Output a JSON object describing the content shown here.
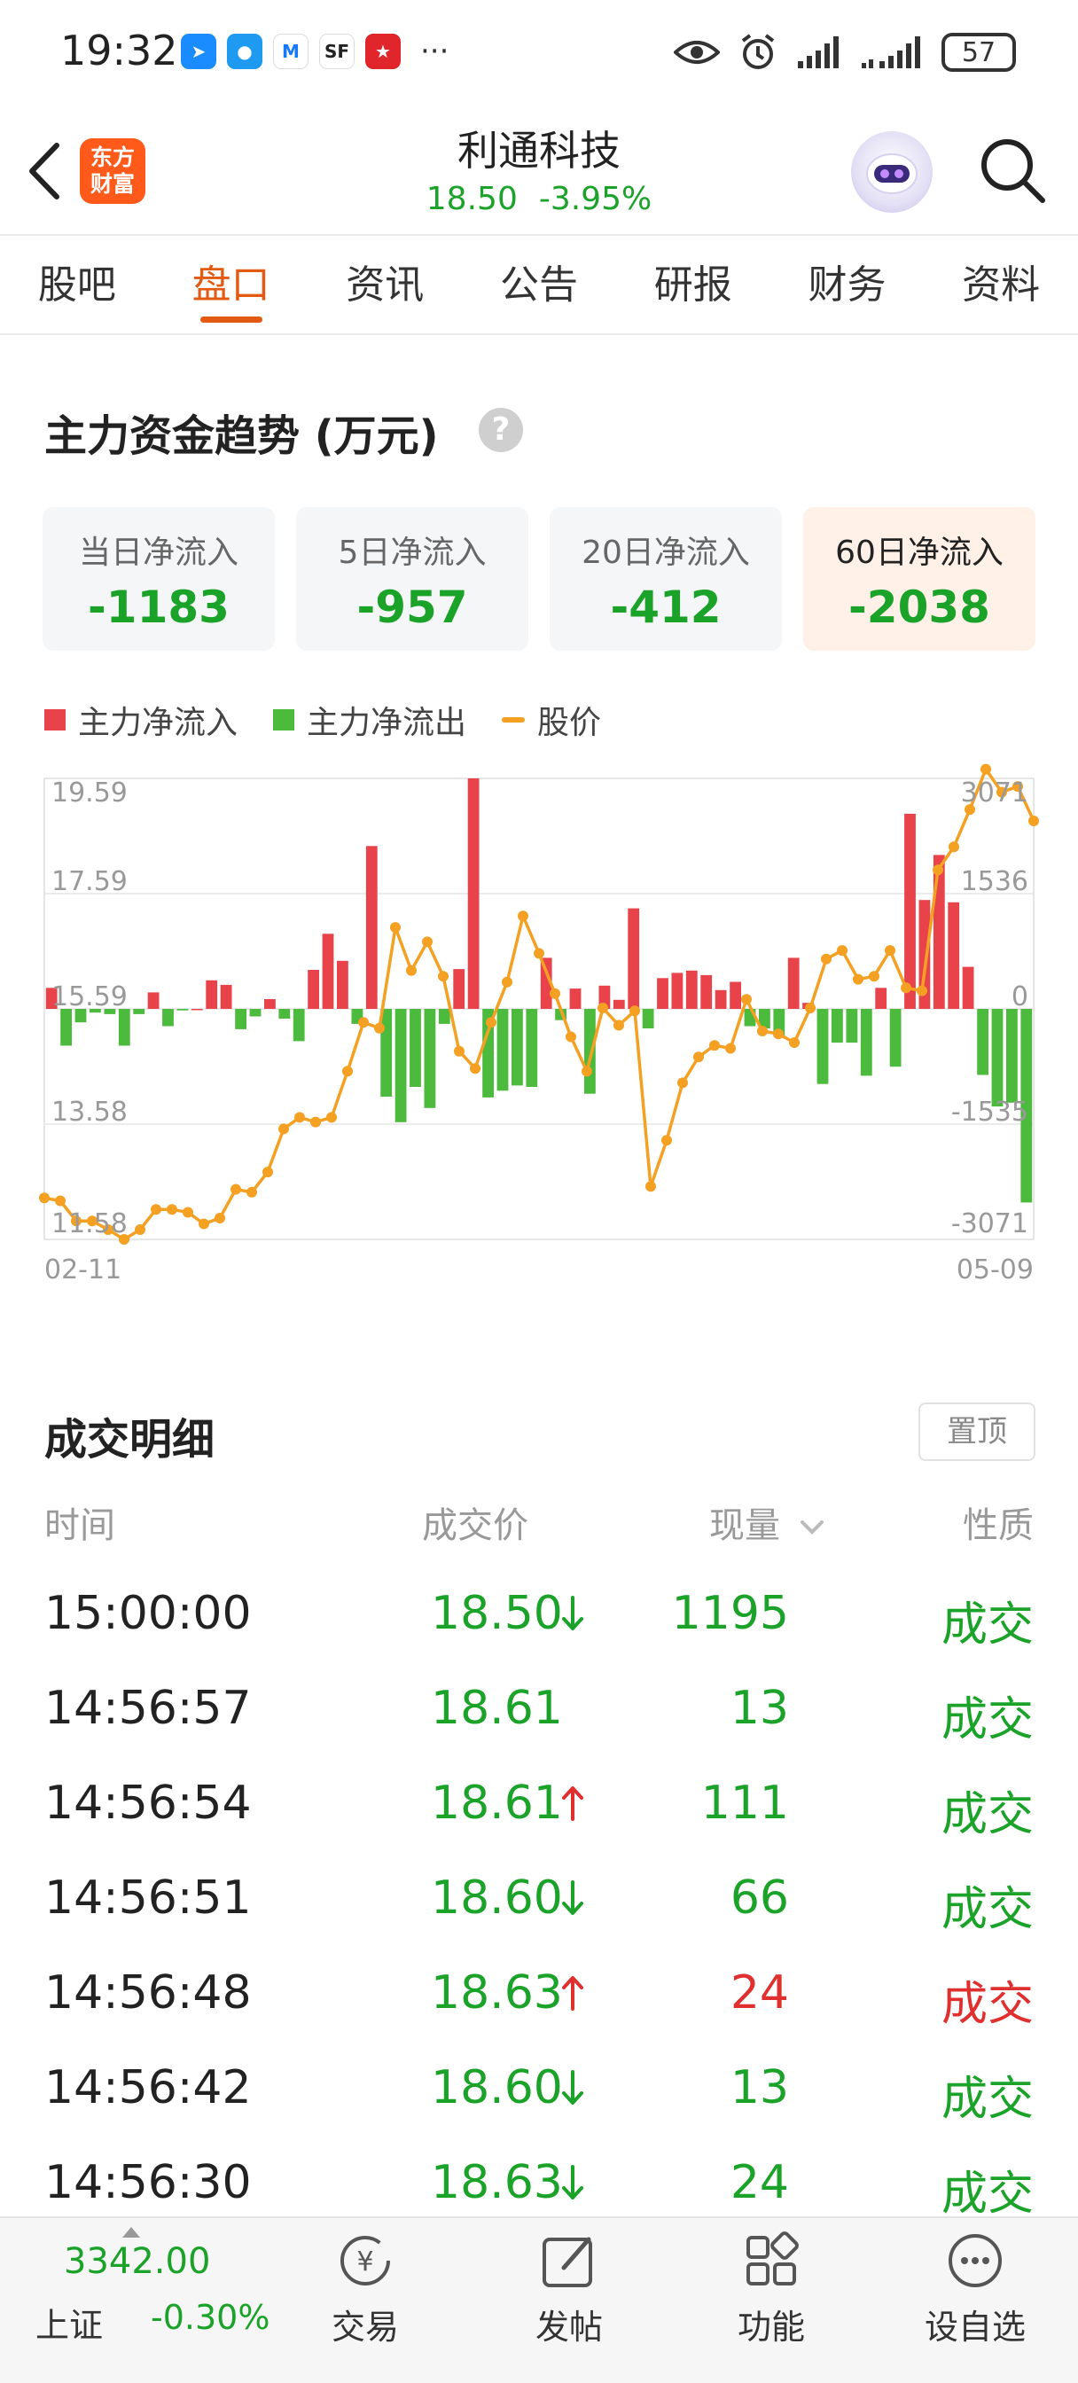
{
  "status_bar": {
    "time": "19:32",
    "battery": "57"
  },
  "header": {
    "brand_logo_text": "东方财富",
    "stock_name": "利通科技",
    "price": "18.50",
    "change_pct": "-3.95%"
  },
  "tabs": [
    {
      "label": "股吧",
      "active": false
    },
    {
      "label": "盘口",
      "active": true
    },
    {
      "label": "资讯",
      "active": false
    },
    {
      "label": "公告",
      "active": false
    },
    {
      "label": "研报",
      "active": false
    },
    {
      "label": "财务",
      "active": false
    },
    {
      "label": "资料",
      "active": false
    }
  ],
  "fund_flow": {
    "title": "主力资金趋势 (万元)",
    "help": "?",
    "cards": [
      {
        "label": "当日净流入",
        "value": "-1183"
      },
      {
        "label": "5日净流入",
        "value": "-957"
      },
      {
        "label": "20日净流入",
        "value": "-412"
      },
      {
        "label": "60日净流入",
        "value": "-2038"
      }
    ],
    "legend": {
      "inflow": "主力净流入",
      "outflow": "主力净流出",
      "price": "股价"
    }
  },
  "chart_data": {
    "type": "bar",
    "x_start_label": "02-11",
    "x_end_label": "05-09",
    "price_ticks": [
      "19.59",
      "17.59",
      "15.59",
      "13.58",
      "11.58"
    ],
    "flow_ticks": [
      "3071",
      "1536",
      "0",
      "-1535",
      "-3071"
    ],
    "price_range": [
      11.58,
      19.59
    ],
    "flow_range": [
      -3071,
      3071
    ],
    "colors": {
      "inflow": "#e8434a",
      "outflow": "#4cba3c",
      "price": "#f4a022"
    },
    "series": [
      {
        "name": "主力净流入/净流出",
        "values": [
          280,
          -490,
          -180,
          -50,
          -70,
          -490,
          -70,
          220,
          -230,
          -20,
          0,
          380,
          320,
          -270,
          -100,
          130,
          -130,
          -430,
          520,
          1000,
          640,
          -200,
          2170,
          -1170,
          -1510,
          -1040,
          -1320,
          -200,
          530,
          3071,
          -1180,
          -1090,
          -1020,
          -1040,
          680,
          -150,
          270,
          -1130,
          310,
          120,
          1340,
          -260,
          410,
          480,
          510,
          450,
          250,
          360,
          -230,
          -260,
          -370,
          680,
          80,
          -1000,
          -450,
          -450,
          -890,
          280,
          -770,
          2600,
          1450,
          2050,
          1420,
          560,
          -880,
          -1300,
          -1250,
          -2580
        ]
      },
      {
        "name": "股价",
        "values": [
          12.3,
          12.25,
          11.9,
          11.9,
          11.75,
          11.58,
          11.75,
          12.1,
          12.1,
          12.05,
          11.85,
          11.95,
          12.45,
          12.4,
          12.75,
          13.5,
          13.7,
          13.62,
          13.7,
          14.5,
          15.35,
          15.25,
          17.0,
          16.25,
          16.75,
          16.15,
          14.85,
          14.55,
          15.35,
          16.05,
          17.2,
          16.55,
          15.85,
          15.1,
          14.5,
          15.6,
          15.3,
          15.55,
          12.5,
          13.3,
          14.3,
          14.75,
          14.95,
          14.9,
          15.75,
          15.2,
          15.15,
          15.0,
          15.6,
          16.45,
          16.6,
          16.1,
          16.15,
          16.6,
          15.95,
          15.9,
          18.0,
          18.4,
          19.05,
          19.75,
          19.35,
          19.45,
          18.85
        ]
      }
    ]
  },
  "trade_detail": {
    "title": "成交明细",
    "pin_label": "置顶",
    "columns": {
      "time": "时间",
      "price": "成交价",
      "volume": "现量",
      "nature": "性质"
    },
    "rows": [
      {
        "time": "15:00:00",
        "price": "18.50",
        "dir": "down",
        "volume": "1195",
        "nature": "成交",
        "color": "#1aa229"
      },
      {
        "time": "14:56:57",
        "price": "18.61",
        "dir": "none",
        "volume": "13",
        "nature": "成交",
        "color": "#1aa229"
      },
      {
        "time": "14:56:54",
        "price": "18.61",
        "dir": "up",
        "volume": "111",
        "nature": "成交",
        "color": "#1aa229"
      },
      {
        "time": "14:56:51",
        "price": "18.60",
        "dir": "down",
        "volume": "66",
        "nature": "成交",
        "color": "#1aa229"
      },
      {
        "time": "14:56:48",
        "price": "18.63",
        "dir": "up",
        "volume": "24",
        "nature": "成交",
        "color": "#e02f2f"
      },
      {
        "time": "14:56:42",
        "price": "18.60",
        "dir": "down",
        "volume": "13",
        "nature": "成交",
        "color": "#1aa229"
      },
      {
        "time": "14:56:30",
        "price": "18.63",
        "dir": "down",
        "volume": "24",
        "nature": "成交",
        "color": "#1aa229"
      }
    ]
  },
  "bottom_bar": {
    "index_value": "3342.00",
    "index_name": "上证",
    "index_change": "-0.30%",
    "nav": [
      {
        "label": "交易",
        "icon": "trade-icon"
      },
      {
        "label": "发帖",
        "icon": "post-icon"
      },
      {
        "label": "功能",
        "icon": "function-icon"
      },
      {
        "label": "设自选",
        "icon": "add-watchlist-icon"
      }
    ]
  }
}
